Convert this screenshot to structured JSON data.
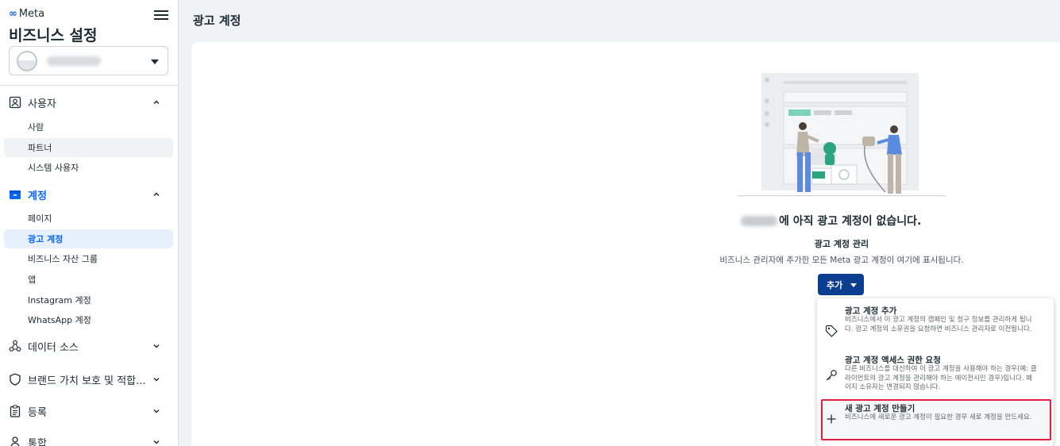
{
  "sidebar": {
    "brand": "Meta",
    "title": "비즈니스 설정",
    "sections": {
      "users": {
        "label": "사용자",
        "items": [
          "사람",
          "파트너",
          "시스템 사용자"
        ]
      },
      "accounts": {
        "label": "계정",
        "items": [
          "페이지",
          "광고 계정",
          "비즈니스 자산 그룹",
          "앱",
          "Instagram 계정",
          "WhatsApp 계정"
        ]
      },
      "data_sources": {
        "label": "데이터 소스"
      },
      "brand_safety": {
        "label": "브랜드 가치 보호 및 적합..."
      },
      "registration": {
        "label": "등록"
      },
      "integrations": {
        "label": "통합"
      }
    }
  },
  "main": {
    "page_title": "광고 계정",
    "empty_title": "에 아직 광고 계정이 없습니다.",
    "sub_heading": "광고 계정 관리",
    "sub_desc": "비즈니스 관리자에 추가한 모든 Meta 광고 계정이 여기에 표시됩니다.",
    "add_button": "추가"
  },
  "dropdown": {
    "options": [
      {
        "title": "광고 계정 추가",
        "desc": "비즈니스에서 이 광고 계정의 캠페인 및 청구 정보를 관리하게 됩니다. 광고 계정의 소유권을 요청하면 비즈니스 관리자로 이전됩니다.",
        "icon": "tag-icon"
      },
      {
        "title": "광고 계정 액세스 권한 요청",
        "desc": "다른 비즈니스를 대신하여 이 광고 계정을 사용해야 하는 경우(예: 클라이언트의 광고 계정을 관리해야 하는 에이전시인 경우)입니다. 페이지 소유자는 변경되지 않습니다.",
        "icon": "key-icon"
      },
      {
        "title": "새 광고 계정 만들기",
        "desc": "비즈니스에 새로운 광고 계정이 필요한 경우 새로 계정을 만드세요.",
        "icon": "plus-icon"
      }
    ]
  },
  "colors": {
    "accent": "#0866ff",
    "button": "#0b3d91",
    "highlight_border": "#e41e3f"
  }
}
